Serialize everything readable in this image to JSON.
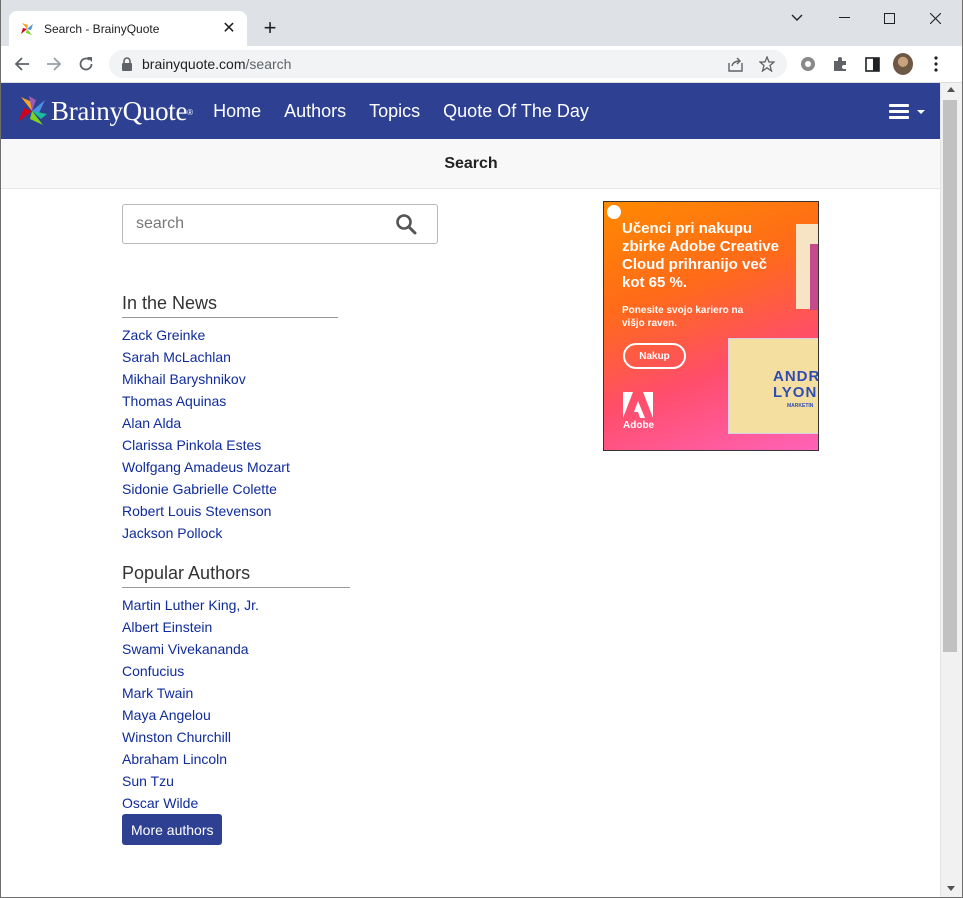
{
  "browser": {
    "tab_title": "Search - BrainyQuote",
    "tab_close_glyph": "✕",
    "new_tab_glyph": "+",
    "url_host": "brainyquote.com",
    "url_path": "/search"
  },
  "site": {
    "logo_text": "BrainyQuote",
    "logo_reg": "®",
    "nav": [
      "Home",
      "Authors",
      "Topics",
      "Quote Of The Day"
    ],
    "page_heading": "Search",
    "search_placeholder": "search",
    "brand_color": "#2e4092"
  },
  "news": {
    "heading": "In the News",
    "items": [
      "Zack Greinke",
      "Sarah McLachlan",
      "Mikhail Baryshnikov",
      "Thomas Aquinas",
      "Alan Alda",
      "Clarissa Pinkola Estes",
      "Wolfgang Amadeus Mozart",
      "Sidonie Gabrielle Colette",
      "Robert Louis Stevenson",
      "Jackson Pollock"
    ]
  },
  "popular": {
    "heading": "Popular Authors",
    "items": [
      "Martin Luther King, Jr.",
      "Albert Einstein",
      "Swami Vivekananda",
      "Confucius",
      "Mark Twain",
      "Maya Angelou",
      "Winston Churchill",
      "Abraham Lincoln",
      "Sun Tzu",
      "Oscar Wilde"
    ],
    "more_label": "More authors"
  },
  "ad": {
    "headline": "Učenci pri nakupu zbirke Adobe Creative Cloud prihranijo več kot 65 %.",
    "sub": "Ponesite svojo kariero na višjo raven.",
    "cta": "Nakup",
    "brand": "Adobe",
    "card_name_1": "ANDR",
    "card_name_2": "LYON",
    "card_role": "MARKETIN"
  }
}
